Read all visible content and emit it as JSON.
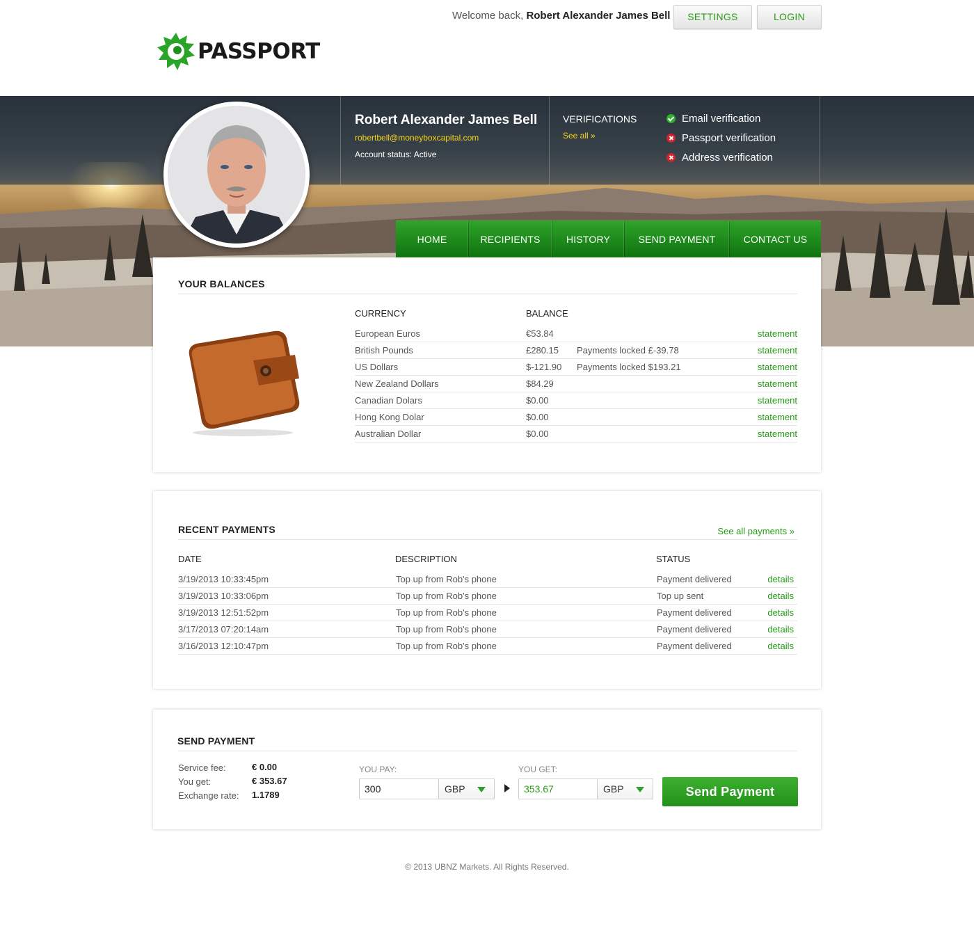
{
  "header": {
    "welcome_prefix": "Welcome back,",
    "user_name": "Robert Alexander James Bell",
    "settings_label": "SETTINGS",
    "login_label": "LOGIN",
    "logo_text": "PASSPORT"
  },
  "profile": {
    "name": "Robert Alexander James Bell",
    "email": "robertbell@moneyboxcapital.com",
    "status": "Account status: Active"
  },
  "verifications": {
    "title": "VERIFICATIONS",
    "see_all": "See all »",
    "items": [
      {
        "label": "Email verification",
        "state": "verified",
        "icon": "check-icon"
      },
      {
        "label": "Passport verification",
        "state": "unverified",
        "icon": "cross-icon"
      },
      {
        "label": "Address verification",
        "state": "unverified",
        "icon": "cross-icon"
      }
    ]
  },
  "nav": {
    "items": [
      "HOME",
      "RECIPIENTS",
      "HISTORY",
      "SEND PAYMENT",
      "CONTACT US"
    ]
  },
  "balances": {
    "title": "YOUR BALANCES",
    "col_currency": "CURRENCY",
    "col_balance": "BALANCE",
    "rows": [
      {
        "currency": "European Euros",
        "balance": "€53.84",
        "note": "",
        "link": "statement"
      },
      {
        "currency": "British Pounds",
        "balance": "£280.15",
        "note": "Payments locked £-39.78",
        "link": "statement"
      },
      {
        "currency": "US Dollars",
        "balance": "$-121.90",
        "note": "Payments locked $193.21",
        "link": "statement"
      },
      {
        "currency": "New Zealand Dollars",
        "balance": "$84.29",
        "note": "",
        "link": "statement"
      },
      {
        "currency": "Canadian Dolars",
        "balance": "$0.00",
        "note": "",
        "link": "statement"
      },
      {
        "currency": "Hong Kong Dolar",
        "balance": "$0.00",
        "note": "",
        "link": "statement"
      },
      {
        "currency": "Australian Dollar",
        "balance": "$0.00",
        "note": "",
        "link": "statement"
      }
    ]
  },
  "payments": {
    "title": "RECENT PAYMENTS",
    "see_all": "See all payments »",
    "col_date": "DATE",
    "col_description": "DESCRIPTION",
    "col_status": "STATUS",
    "rows": [
      {
        "date": "3/19/2013 10:33:45pm",
        "description": "Top up from Rob's phone",
        "status": "Payment delivered",
        "link": "details"
      },
      {
        "date": "3/19/2013 10:33:06pm",
        "description": "Top up from Rob's phone",
        "status": "Top up sent",
        "link": "details"
      },
      {
        "date": "3/19/2013 12:51:52pm",
        "description": "Top up from Rob's phone",
        "status": "Payment delivered",
        "link": "details"
      },
      {
        "date": "3/17/2013 07:20:14am",
        "description": "Top up from Rob's phone",
        "status": "Payment delivered",
        "link": "details"
      },
      {
        "date": "3/16/2013 12:10:47pm",
        "description": "Top up from Rob's phone",
        "status": "Payment delivered",
        "link": "details"
      }
    ]
  },
  "send": {
    "title": "SEND PAYMENT",
    "service_fee_label": "Service fee:",
    "service_fee": "€ 0.00",
    "you_get_label": "You get:",
    "you_get": "€ 353.67",
    "rate_label": "Exchange rate:",
    "rate": "1.1789",
    "you_pay_caption": "YOU PAY:",
    "you_get_caption": "YOU GET:",
    "pay_amount": "300",
    "pay_currency": "GBP",
    "get_amount": "353.67",
    "get_currency": "GBP",
    "button": "Send Payment"
  },
  "footer": {
    "text": "© 2013 UBNZ Markets. All Rights Reserved."
  },
  "colors": {
    "brand_green": "#2ea32a",
    "link_green": "#249b16",
    "email_yellow": "#f6d31a",
    "error_red": "#d3232a"
  }
}
